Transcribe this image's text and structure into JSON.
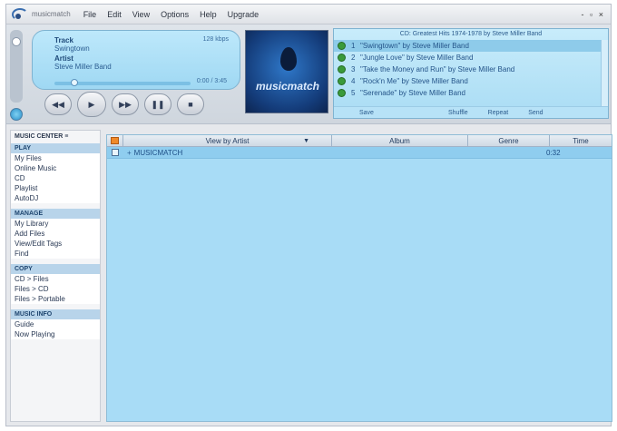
{
  "menubar": {
    "app_title": "musicmatch",
    "items": [
      "File",
      "Edit",
      "View",
      "Options",
      "Help",
      "Upgrade"
    ],
    "window_controls": "- ▫ ×"
  },
  "player": {
    "track_label": "Track",
    "track_value": "Swingtown",
    "artist_label": "Artist",
    "artist_value": "Steve Miller Band",
    "meta": "128 kbps",
    "time": "0:00 / 3:45",
    "controls": [
      "◀◀",
      "▶",
      "▶▶",
      "❚❚",
      "■"
    ],
    "album_art_text": "musicmatch"
  },
  "playlist": {
    "header": "CD: Greatest Hits 1974-1978 by Steve Miller Band",
    "rows": [
      {
        "num": "1",
        "title": "\"Swingtown\" by Steve Miller Band"
      },
      {
        "num": "2",
        "title": "\"Jungle Love\" by Steve Miller Band"
      },
      {
        "num": "3",
        "title": "\"Take the Money and Run\" by Steve Miller Band"
      },
      {
        "num": "4",
        "title": "\"Rock'n Me\" by Steve Miller Band"
      },
      {
        "num": "5",
        "title": "\"Serenade\" by Steve Miller Band"
      }
    ],
    "footer": [
      "Save",
      "Shuffle",
      "Repeat",
      "Send"
    ]
  },
  "sidebar": {
    "title": "MUSIC CENTER ≡",
    "sections": [
      {
        "heading": "PLAY",
        "items": [
          "My Files",
          "Online Music",
          "CD",
          "Playlist",
          "AutoDJ"
        ]
      },
      {
        "heading": "MANAGE",
        "items": [
          "My Library",
          "Add Files",
          "View/Edit Tags",
          "Find"
        ]
      },
      {
        "heading": "COPY",
        "items": [
          "CD > Files",
          "Files > CD",
          "Files > Portable"
        ]
      },
      {
        "heading": "MUSIC INFO",
        "items": [
          "Guide",
          "Now Playing"
        ]
      }
    ]
  },
  "library": {
    "columns": {
      "artist": "View by Artist",
      "album": "Album",
      "genre": "Genre",
      "time": "Time"
    },
    "rows": [
      {
        "name": "MUSICMATCH",
        "time": "0:32"
      }
    ]
  }
}
